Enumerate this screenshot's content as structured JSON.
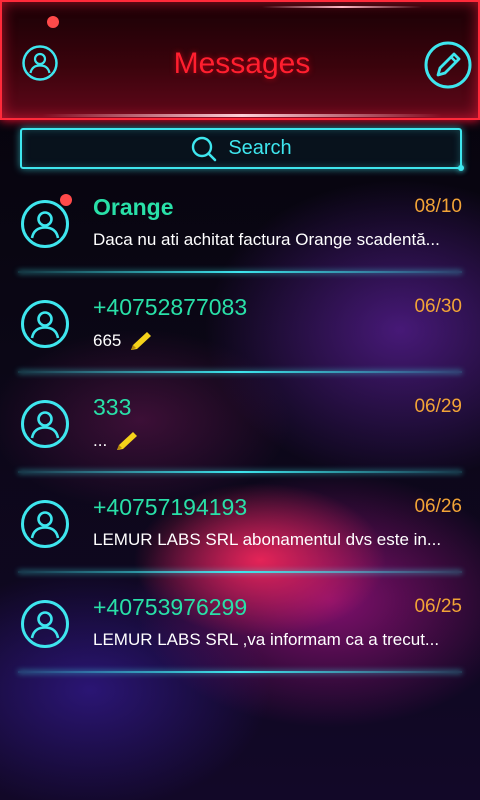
{
  "header": {
    "title": "Messages",
    "profile_icon": "person-circle-icon",
    "compose_icon": "pencil-circle-icon",
    "accent": "#ff2a3a"
  },
  "search": {
    "label": "Search",
    "icon": "search-icon",
    "accent": "#3ee6ee"
  },
  "conversations": [
    {
      "name": "Orange",
      "date": "08/10",
      "snippet": "Daca nu ati achitat factura Orange scadentă...",
      "unread": true,
      "draft": false
    },
    {
      "name": "+40752877083",
      "date": "06/30",
      "snippet": "665",
      "unread": false,
      "draft": true
    },
    {
      "name": "333",
      "date": "06/29",
      "snippet": "...",
      "unread": false,
      "draft": true
    },
    {
      "name": "+40757194193",
      "date": "06/26",
      "snippet": "LEMUR LABS SRL  abonamentul dvs este in...",
      "unread": false,
      "draft": false
    },
    {
      "name": "+40753976299",
      "date": "06/25",
      "snippet": "LEMUR LABS SRL ,va informam ca a trecut...",
      "unread": false,
      "draft": false
    }
  ],
  "colors": {
    "name": "#29e0a8",
    "date": "#f2a437",
    "unread_dot": "#ff4a4a",
    "draft_pencil": "#f5d21a"
  }
}
